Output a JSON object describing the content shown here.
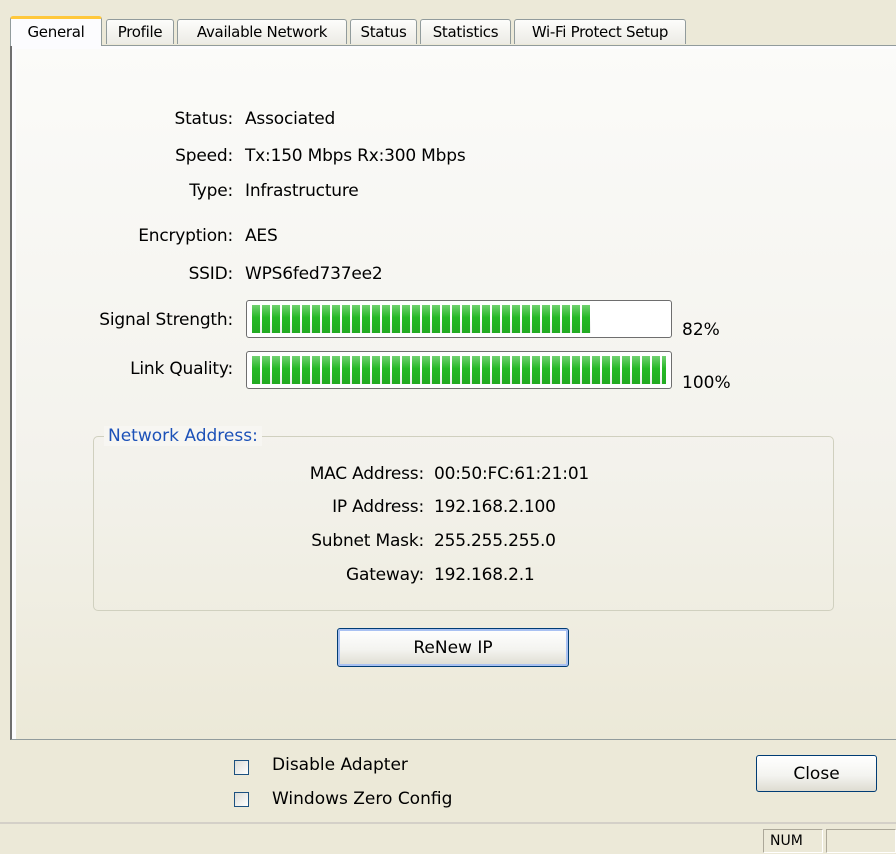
{
  "tabs": [
    "General",
    "Profile",
    "Available Network",
    "Status",
    "Statistics",
    "Wi-Fi Protect Setup"
  ],
  "general": {
    "status_label": "Status:",
    "status_value": "Associated",
    "speed_label": "Speed:",
    "speed_value": "Tx:150 Mbps Rx:300 Mbps",
    "type_label": "Type:",
    "type_value": "Infrastructure",
    "encryption_label": "Encryption:",
    "encryption_value": "AES",
    "ssid_label": "SSID:",
    "ssid_value": "WPS6fed737ee2"
  },
  "signal": {
    "label": "Signal Strength:",
    "percent_text": "82%",
    "fraction": 0.82
  },
  "link": {
    "label": "Link Quality:",
    "percent_text": "100%",
    "fraction": 1.0
  },
  "network_address": {
    "title": "Network Address:",
    "mac_label": "MAC Address:",
    "mac_value": "00:50:FC:61:21:01",
    "ip_label": "IP Address:",
    "ip_value": "192.168.2.100",
    "subnet_label": "Subnet Mask:",
    "subnet_value": "255.255.255.0",
    "gateway_label": "Gateway:",
    "gateway_value": "192.168.2.1"
  },
  "renew_button": "ReNew IP",
  "disable_adapter": {
    "label": "Disable Adapter",
    "checked": false
  },
  "windows_zero_config": {
    "label": "Windows Zero Config",
    "checked": false
  },
  "close_button": "Close",
  "statusbar": {
    "num_indicator": "NUM"
  },
  "colors": {
    "bar_green": "#25b925",
    "group_title_blue": "#1c51b8",
    "active_tab_accent": "#ffc83c"
  }
}
